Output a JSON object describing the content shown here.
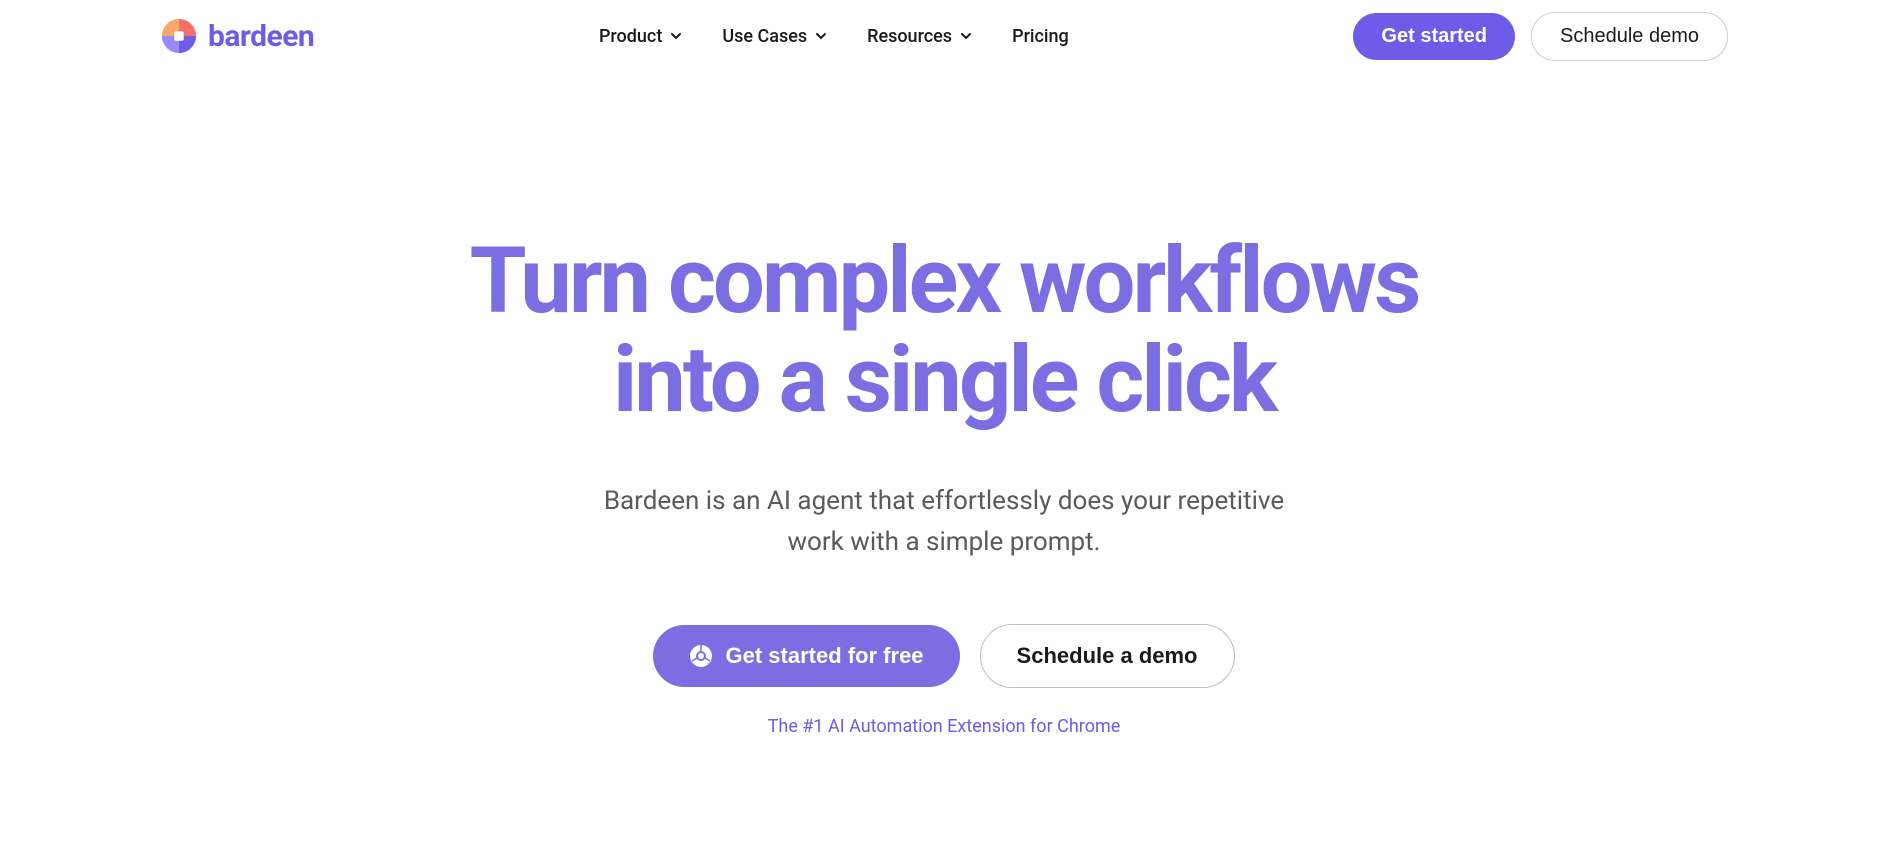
{
  "brand": {
    "name": "bardeen"
  },
  "nav": {
    "items": [
      {
        "label": "Product",
        "hasDropdown": true
      },
      {
        "label": "Use Cases",
        "hasDropdown": true
      },
      {
        "label": "Resources",
        "hasDropdown": true
      },
      {
        "label": "Pricing",
        "hasDropdown": false
      }
    ]
  },
  "header": {
    "cta_primary": "Get started",
    "cta_secondary": "Schedule demo"
  },
  "hero": {
    "title_line1": "Turn complex workflows",
    "title_line2": "into a single click",
    "subtitle": "Bardeen is an AI agent that effortlessly does your repetitive work with a simple prompt.",
    "cta_primary": "Get started for free",
    "cta_secondary": "Schedule a demo",
    "tagline": "The #1 AI Automation Extension for Chrome"
  },
  "colors": {
    "primary": "#6C5CE7",
    "primary_light": "#7B6EE3",
    "text_dark": "#1a1a1a",
    "text_muted": "#5a5a5a"
  }
}
